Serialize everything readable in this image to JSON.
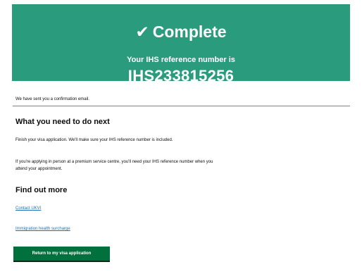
{
  "confirmation_panel": {
    "tick_icon": "check-mark-icon",
    "title": "Complete",
    "subtitle": "Your IHS reference number is",
    "reference_number": "IHS233815256",
    "background_color": "#2b9b7d"
  },
  "email_note": "We have sent you a confirmation email.",
  "next_steps": {
    "heading": "What you need to do next",
    "paragraphs": [
      "Finish your visa application. We'll make sure your IHS reference number is included.",
      "If you're applying in person at a premium service centre, you'll need your IHS reference number when you attend your appointment."
    ]
  },
  "find_out_more": {
    "heading": "Find out more",
    "links": [
      "Contact UKVI",
      "Immigration health surcharge"
    ]
  },
  "return_button": {
    "label": "Return to my visa application",
    "color": "#00703c"
  }
}
